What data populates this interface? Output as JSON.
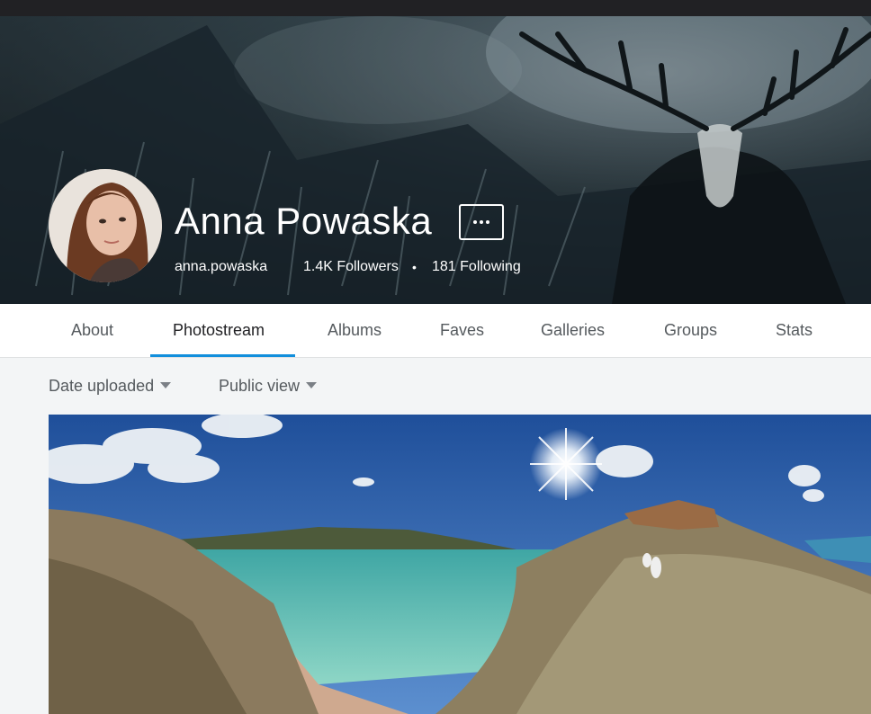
{
  "profile": {
    "name": "Anna Powaska",
    "username": "anna.powaska",
    "followers": "1.4K Followers",
    "separator": "•",
    "following": "181 Following"
  },
  "nav": {
    "tabs": [
      "About",
      "Photostream",
      "Albums",
      "Faves",
      "Galleries",
      "Groups",
      "Stats"
    ],
    "active": "Photostream"
  },
  "filters": {
    "sort": "Date uploaded",
    "view": "Public view"
  },
  "icons": {
    "more": "more-dots-icon",
    "dropdown": "caret-down-icon"
  },
  "colors": {
    "accent": "#128fdc",
    "topbar": "#212124",
    "page_bg": "#f3f5f6"
  }
}
